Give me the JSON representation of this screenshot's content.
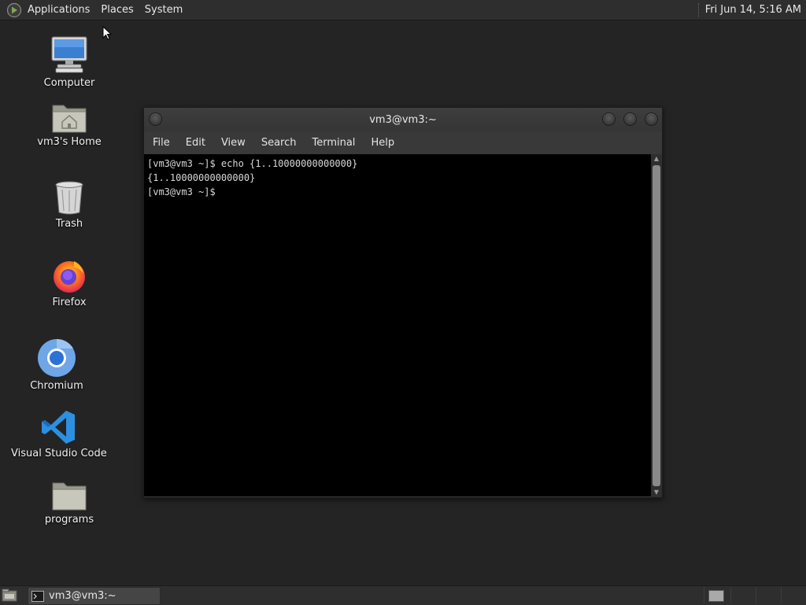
{
  "top_panel": {
    "menus": [
      "Applications",
      "Places",
      "System"
    ],
    "clock": "Fri Jun 14,  5:16 AM"
  },
  "desktop_icons": [
    {
      "label": "Computer",
      "icon": "computer-icon"
    },
    {
      "label": "vm3's Home",
      "icon": "home-folder-icon"
    },
    {
      "label": "Trash",
      "icon": "trash-icon"
    },
    {
      "label": "Firefox",
      "icon": "firefox-icon"
    },
    {
      "label": "Chromium",
      "icon": "chromium-icon"
    },
    {
      "label": "Visual Studio Code",
      "icon": "vscode-icon"
    },
    {
      "label": "programs",
      "icon": "folder-icon"
    }
  ],
  "terminal_window": {
    "title": "vm3@vm3:~",
    "menu": [
      "File",
      "Edit",
      "View",
      "Search",
      "Terminal",
      "Help"
    ],
    "lines": [
      "[vm3@vm3 ~]$ echo {1..10000000000000}",
      "{1..10000000000000}",
      "[vm3@vm3 ~]$ "
    ]
  },
  "bottom_panel": {
    "task_label": "vm3@vm3:~"
  }
}
